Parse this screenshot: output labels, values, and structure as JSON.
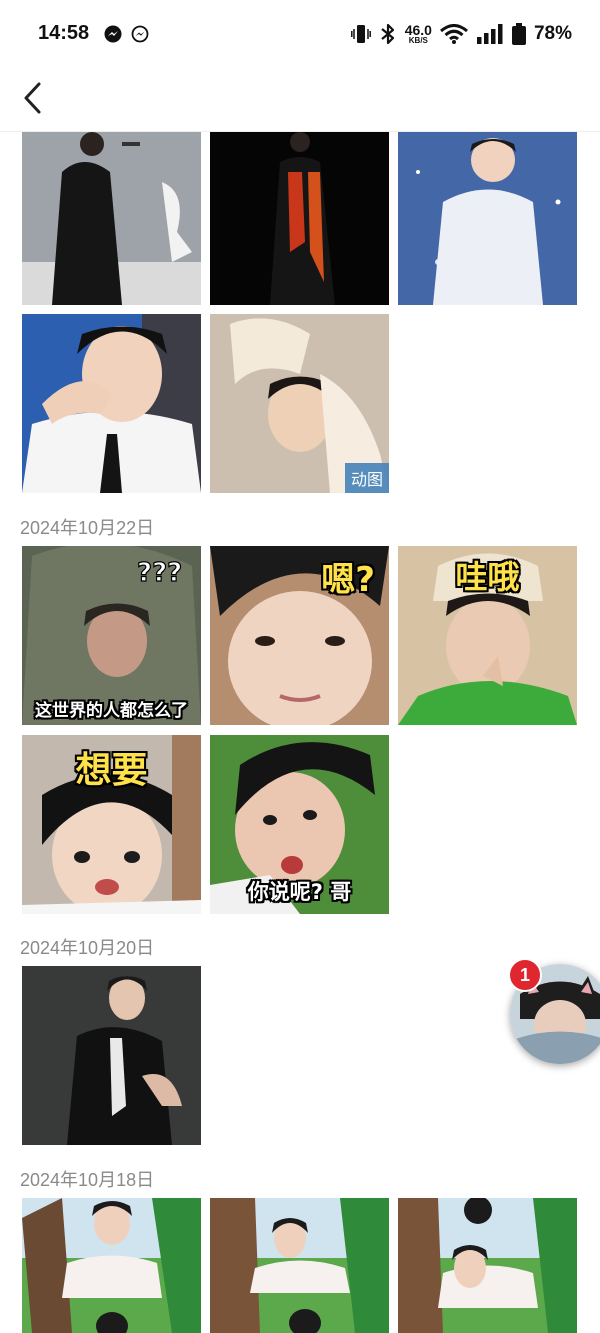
{
  "status_bar": {
    "time": "14:58",
    "network_speed_value": "46.0",
    "network_speed_unit": "KB/S",
    "battery_percent": "78%"
  },
  "header": {
    "back_icon": "chevron-left-icon"
  },
  "gallery": {
    "badge_gif": "动图",
    "sections": [
      {
        "date": "2024年10月22日",
        "captions": [
          "这世界的人都怎么了",
          "嗯?",
          "哇哦",
          "想要",
          "你说呢? 哥"
        ]
      },
      {
        "date": "2024年10月20日"
      },
      {
        "date": "2024年10月18日"
      }
    ]
  },
  "floating_chat": {
    "notification_count": "1"
  },
  "colors": {
    "date_text": "#8a8a8a",
    "badge_bg": "#4682b9",
    "notif_red": "#e0262f",
    "caption_yellow": "#ffe14a"
  }
}
